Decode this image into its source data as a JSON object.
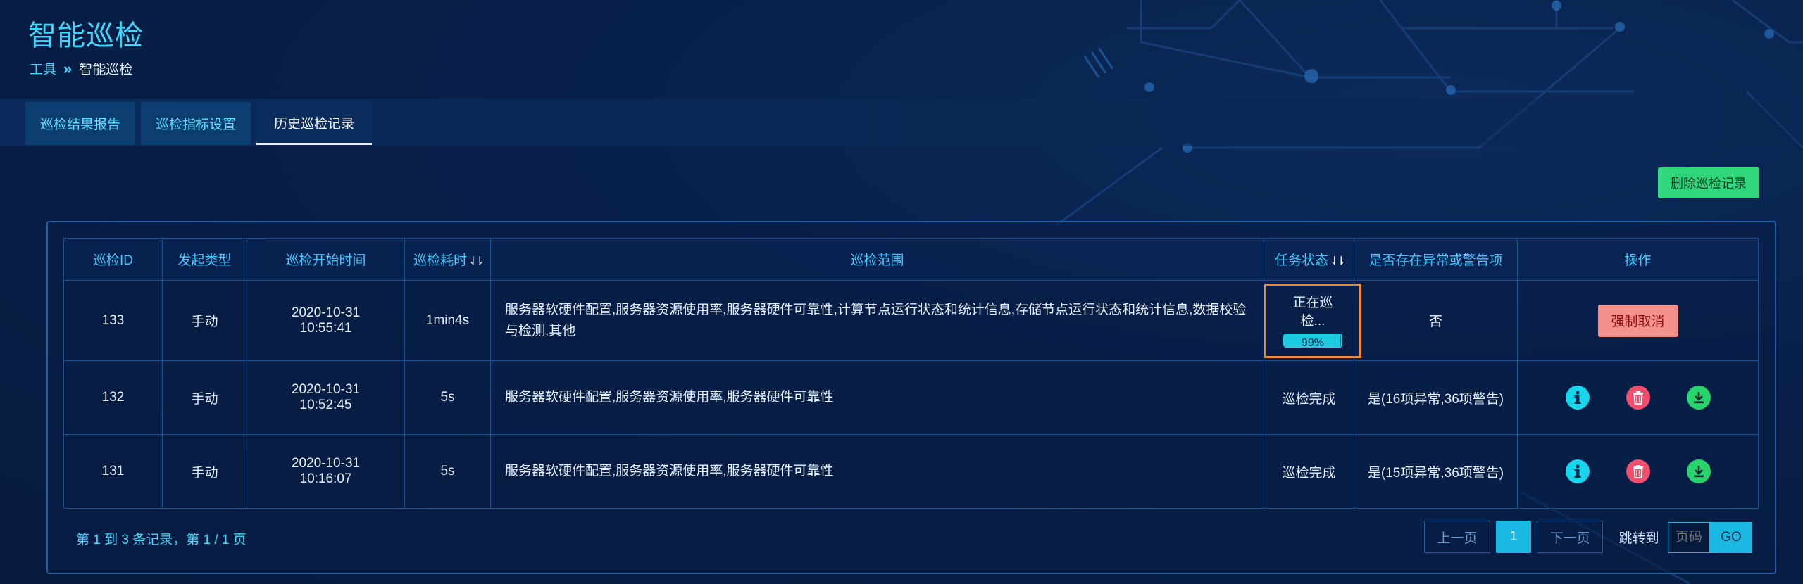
{
  "page": {
    "title": "智能巡检"
  },
  "breadcrumb": {
    "parent": "工具",
    "separator": "»",
    "current": "智能巡检"
  },
  "tabs": [
    {
      "label": "巡检结果报告",
      "active": false
    },
    {
      "label": "巡检指标设置",
      "active": false
    },
    {
      "label": "历史巡检记录",
      "active": true
    }
  ],
  "toolbar": {
    "delete_label": "删除巡检记录"
  },
  "table": {
    "headers": {
      "id": "巡检ID",
      "type": "发起类型",
      "start": "巡检开始时间",
      "duration": "巡检耗时",
      "scope": "巡检范围",
      "status": "任务状态",
      "anomaly": "是否存在异常或警告项",
      "ops": "操作"
    },
    "rows": [
      {
        "id": "133",
        "type": "手动",
        "date": "2020-10-31",
        "time": "10:55:41",
        "duration": "1min4s",
        "scope": "服务器软硬件配置,服务器资源使用率,服务器硬件可靠性,计算节点运行状态和统计信息,存储节点运行状态和统计信息,数据校验与检测,其他",
        "status": "正在巡检...",
        "progress": 99,
        "progress_label": "99%",
        "anomaly": "否",
        "action": "强制取消"
      },
      {
        "id": "132",
        "type": "手动",
        "date": "2020-10-31",
        "time": "10:52:45",
        "duration": "5s",
        "scope": "服务器软硬件配置,服务器资源使用率,服务器硬件可靠性",
        "status": "巡检完成",
        "anomaly": "是(16项异常,36项警告)"
      },
      {
        "id": "131",
        "type": "手动",
        "date": "2020-10-31",
        "time": "10:16:07",
        "duration": "5s",
        "scope": "服务器软硬件配置,服务器资源使用率,服务器硬件可靠性",
        "status": "巡检完成",
        "anomaly": "是(15项异常,36项警告)"
      }
    ]
  },
  "footer": {
    "summary": "第 1 到 3 条记录，第 1 / 1 页"
  },
  "pager": {
    "prev": "上一页",
    "current": "1",
    "next": "下一页",
    "jump_label": "跳转到",
    "input_placeholder": "页码",
    "go": "GO"
  },
  "icons": {
    "sort": "sort-icon",
    "info": "info-icon",
    "delete": "trash-icon",
    "download": "download-icon"
  },
  "colors": {
    "accent": "#3fd8ff",
    "delete_button": "#2fd67c",
    "cancel_button": "#f4918c",
    "status_highlight": "#f08a32",
    "info_icon": "#16d6ee",
    "trash_icon": "#f04f6e",
    "download_icon": "#26d66c"
  }
}
